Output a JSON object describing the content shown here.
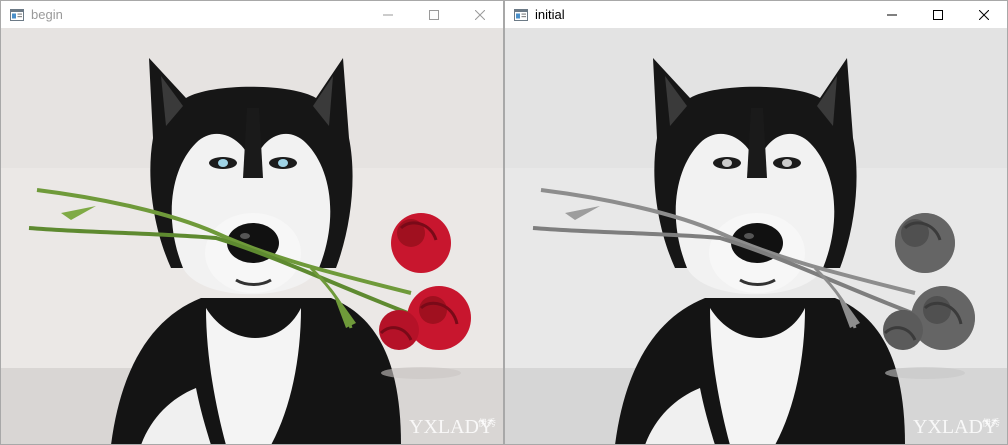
{
  "windows": [
    {
      "title": "begin",
      "active": false,
      "image_mode": "color",
      "watermark": "YXLADY",
      "watermark_small": "伊秀"
    },
    {
      "title": "initial",
      "active": true,
      "image_mode": "grayscale",
      "watermark": "YXLADY",
      "watermark_small": "伊秀"
    }
  ],
  "icons": {
    "app": "opencv-window-icon",
    "minimize": "minimize-icon",
    "maximize": "maximize-icon",
    "close": "close-icon"
  },
  "colors": {
    "rose": "#c8162e",
    "rose_dark": "#7a0a18",
    "stem": "#6f9a3a",
    "fur_dark": "#141414",
    "background": "#e9e6e4",
    "title_inactive": "#9a9a9a",
    "title_active": "#000000"
  }
}
